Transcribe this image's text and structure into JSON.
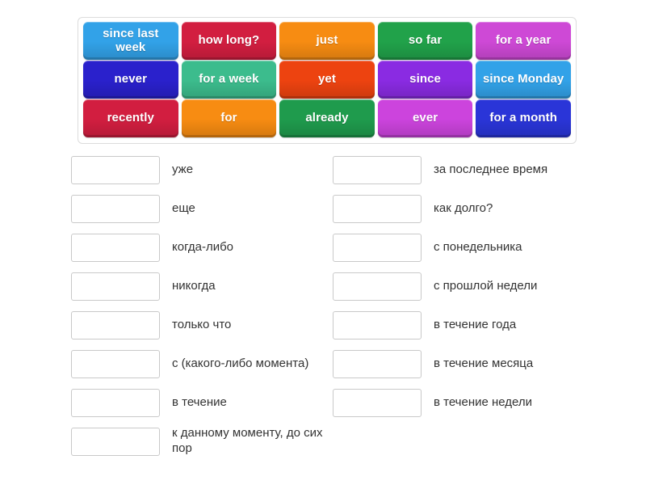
{
  "tile_bank": {
    "rows": [
      [
        {
          "label": "since last week",
          "color": "#32A2E8"
        },
        {
          "label": "how long?",
          "color": "#D21E40"
        },
        {
          "label": "just",
          "color": "#F78C12"
        },
        {
          "label": "so far",
          "color": "#21A24A"
        },
        {
          "label": "for a year",
          "color": "#CE49D6"
        }
      ],
      [
        {
          "label": "never",
          "color": "#2A21CC"
        },
        {
          "label": "for a week",
          "color": "#3CBC8D"
        },
        {
          "label": "yet",
          "color": "#ED4310"
        },
        {
          "label": "since",
          "color": "#8A2BE2"
        },
        {
          "label": "since Monday",
          "color": "#32A2E8"
        }
      ],
      [
        {
          "label": "recently",
          "color": "#D21E40"
        },
        {
          "label": "for",
          "color": "#F78C12"
        },
        {
          "label": "already",
          "color": "#1F9B4D"
        },
        {
          "label": "ever",
          "color": "#CC44DD"
        },
        {
          "label": "for a month",
          "color": "#2A35D8"
        }
      ]
    ]
  },
  "answers": {
    "left_column": [
      {
        "label": "уже"
      },
      {
        "label": "еще"
      },
      {
        "label": "когда-либо"
      },
      {
        "label": "никогда"
      },
      {
        "label": "только что"
      },
      {
        "label": "с (какого-либо момента)"
      },
      {
        "label": "в течение"
      },
      {
        "label": "к данному моменту, до сих пор"
      }
    ],
    "right_column": [
      {
        "label": "за последнее время"
      },
      {
        "label": "как долго?"
      },
      {
        "label": "с понедельника"
      },
      {
        "label": "с прошлой недели"
      },
      {
        "label": "в течение года"
      },
      {
        "label": "в течение месяца"
      },
      {
        "label": "в течение недели"
      }
    ]
  }
}
